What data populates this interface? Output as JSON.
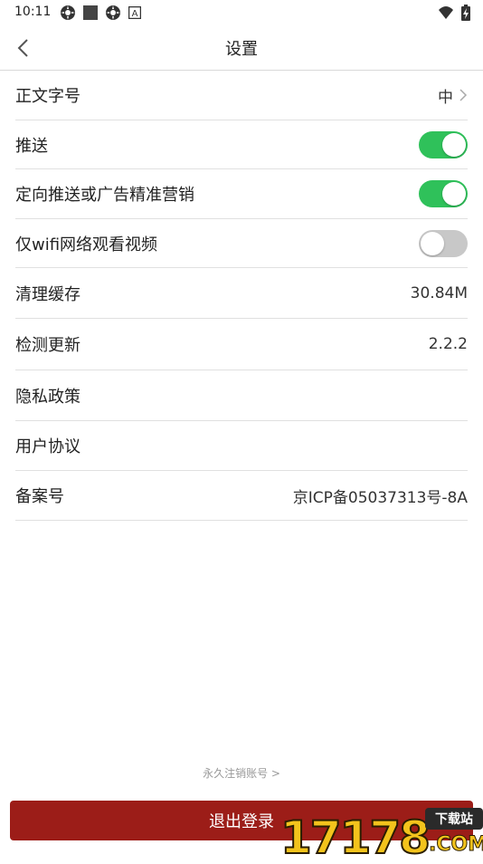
{
  "status_bar": {
    "time": "10:11",
    "left_icons": [
      "settings-gear-icon",
      "square-icon",
      "settings-gear-icon",
      "a-box-icon"
    ],
    "right_icons": [
      "wifi-icon",
      "battery-charging-icon"
    ]
  },
  "nav": {
    "title": "设置",
    "back_icon": "chevron-left-icon"
  },
  "settings": {
    "font_size": {
      "label": "正文字号",
      "value": "中"
    },
    "push": {
      "label": "推送",
      "on": true
    },
    "targeted": {
      "label": "定向推送或广告精准营销",
      "on": true
    },
    "wifi_only": {
      "label": "仅wifi网络观看视频",
      "on": false
    },
    "cache": {
      "label": "清理缓存",
      "value": "30.84M"
    },
    "update": {
      "label": "检测更新",
      "value": "2.2.2"
    },
    "privacy": {
      "label": "隐私政策"
    },
    "agreement": {
      "label": "用户协议"
    },
    "icp": {
      "label": "备案号",
      "value": "京ICP备05037313号-8A"
    }
  },
  "footer": {
    "cancel_account": "永久注销账号 >",
    "logout": "退出登录"
  },
  "watermark": {
    "digits": "17178",
    "badge": "下载站",
    "suffix": ".COM"
  },
  "colors": {
    "toggle_on": "#2fc15a",
    "toggle_off": "#c8c8c8",
    "logout_bg": "#9c1d18"
  }
}
